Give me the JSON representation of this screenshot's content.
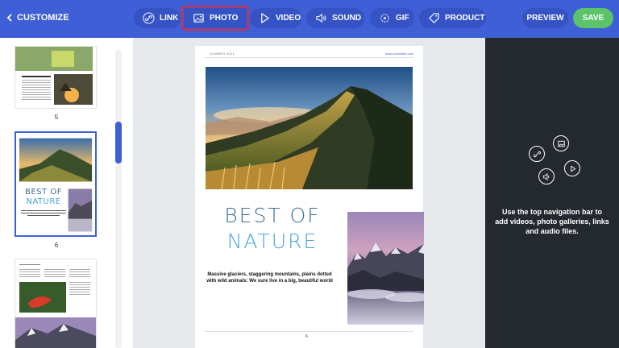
{
  "topbar": {
    "back_label": "CUSTOMIZE",
    "buttons": [
      {
        "label": "LINK",
        "icon": "link-icon"
      },
      {
        "label": "PHOTO",
        "icon": "photo-icon",
        "selected": true
      },
      {
        "label": "VIDEO",
        "icon": "video-icon"
      },
      {
        "label": "SOUND",
        "icon": "sound-icon"
      },
      {
        "label": "GIF",
        "icon": "gif-icon"
      },
      {
        "label": "PRODUCT",
        "icon": "tag-icon"
      }
    ],
    "preview_label": "PREVIEW",
    "save_label": "SAVE",
    "colors": {
      "bar": "#3f5fd6",
      "button": "#3553c4",
      "save": "#5bc46a",
      "highlight": "#e0283d"
    }
  },
  "thumbnails": [
    {
      "page": "5"
    },
    {
      "page": "6",
      "selected": true,
      "title_line1": "BEST OF",
      "title_line2": "NATURE"
    },
    {
      "page": ""
    }
  ],
  "page": {
    "header_left": "SUMMER 2021",
    "header_right": "www.nosiuweb.com",
    "title_line1": "BEST OF",
    "title_line2": "NATURE",
    "caption": "Massive glaciers, staggering mountains, plains dotted with wild animals: We sure live in a big, beautiful world",
    "page_number": "6"
  },
  "rightpanel": {
    "help_text": "Use the top navigation bar to add videos, photo galleries, links and audio files."
  }
}
